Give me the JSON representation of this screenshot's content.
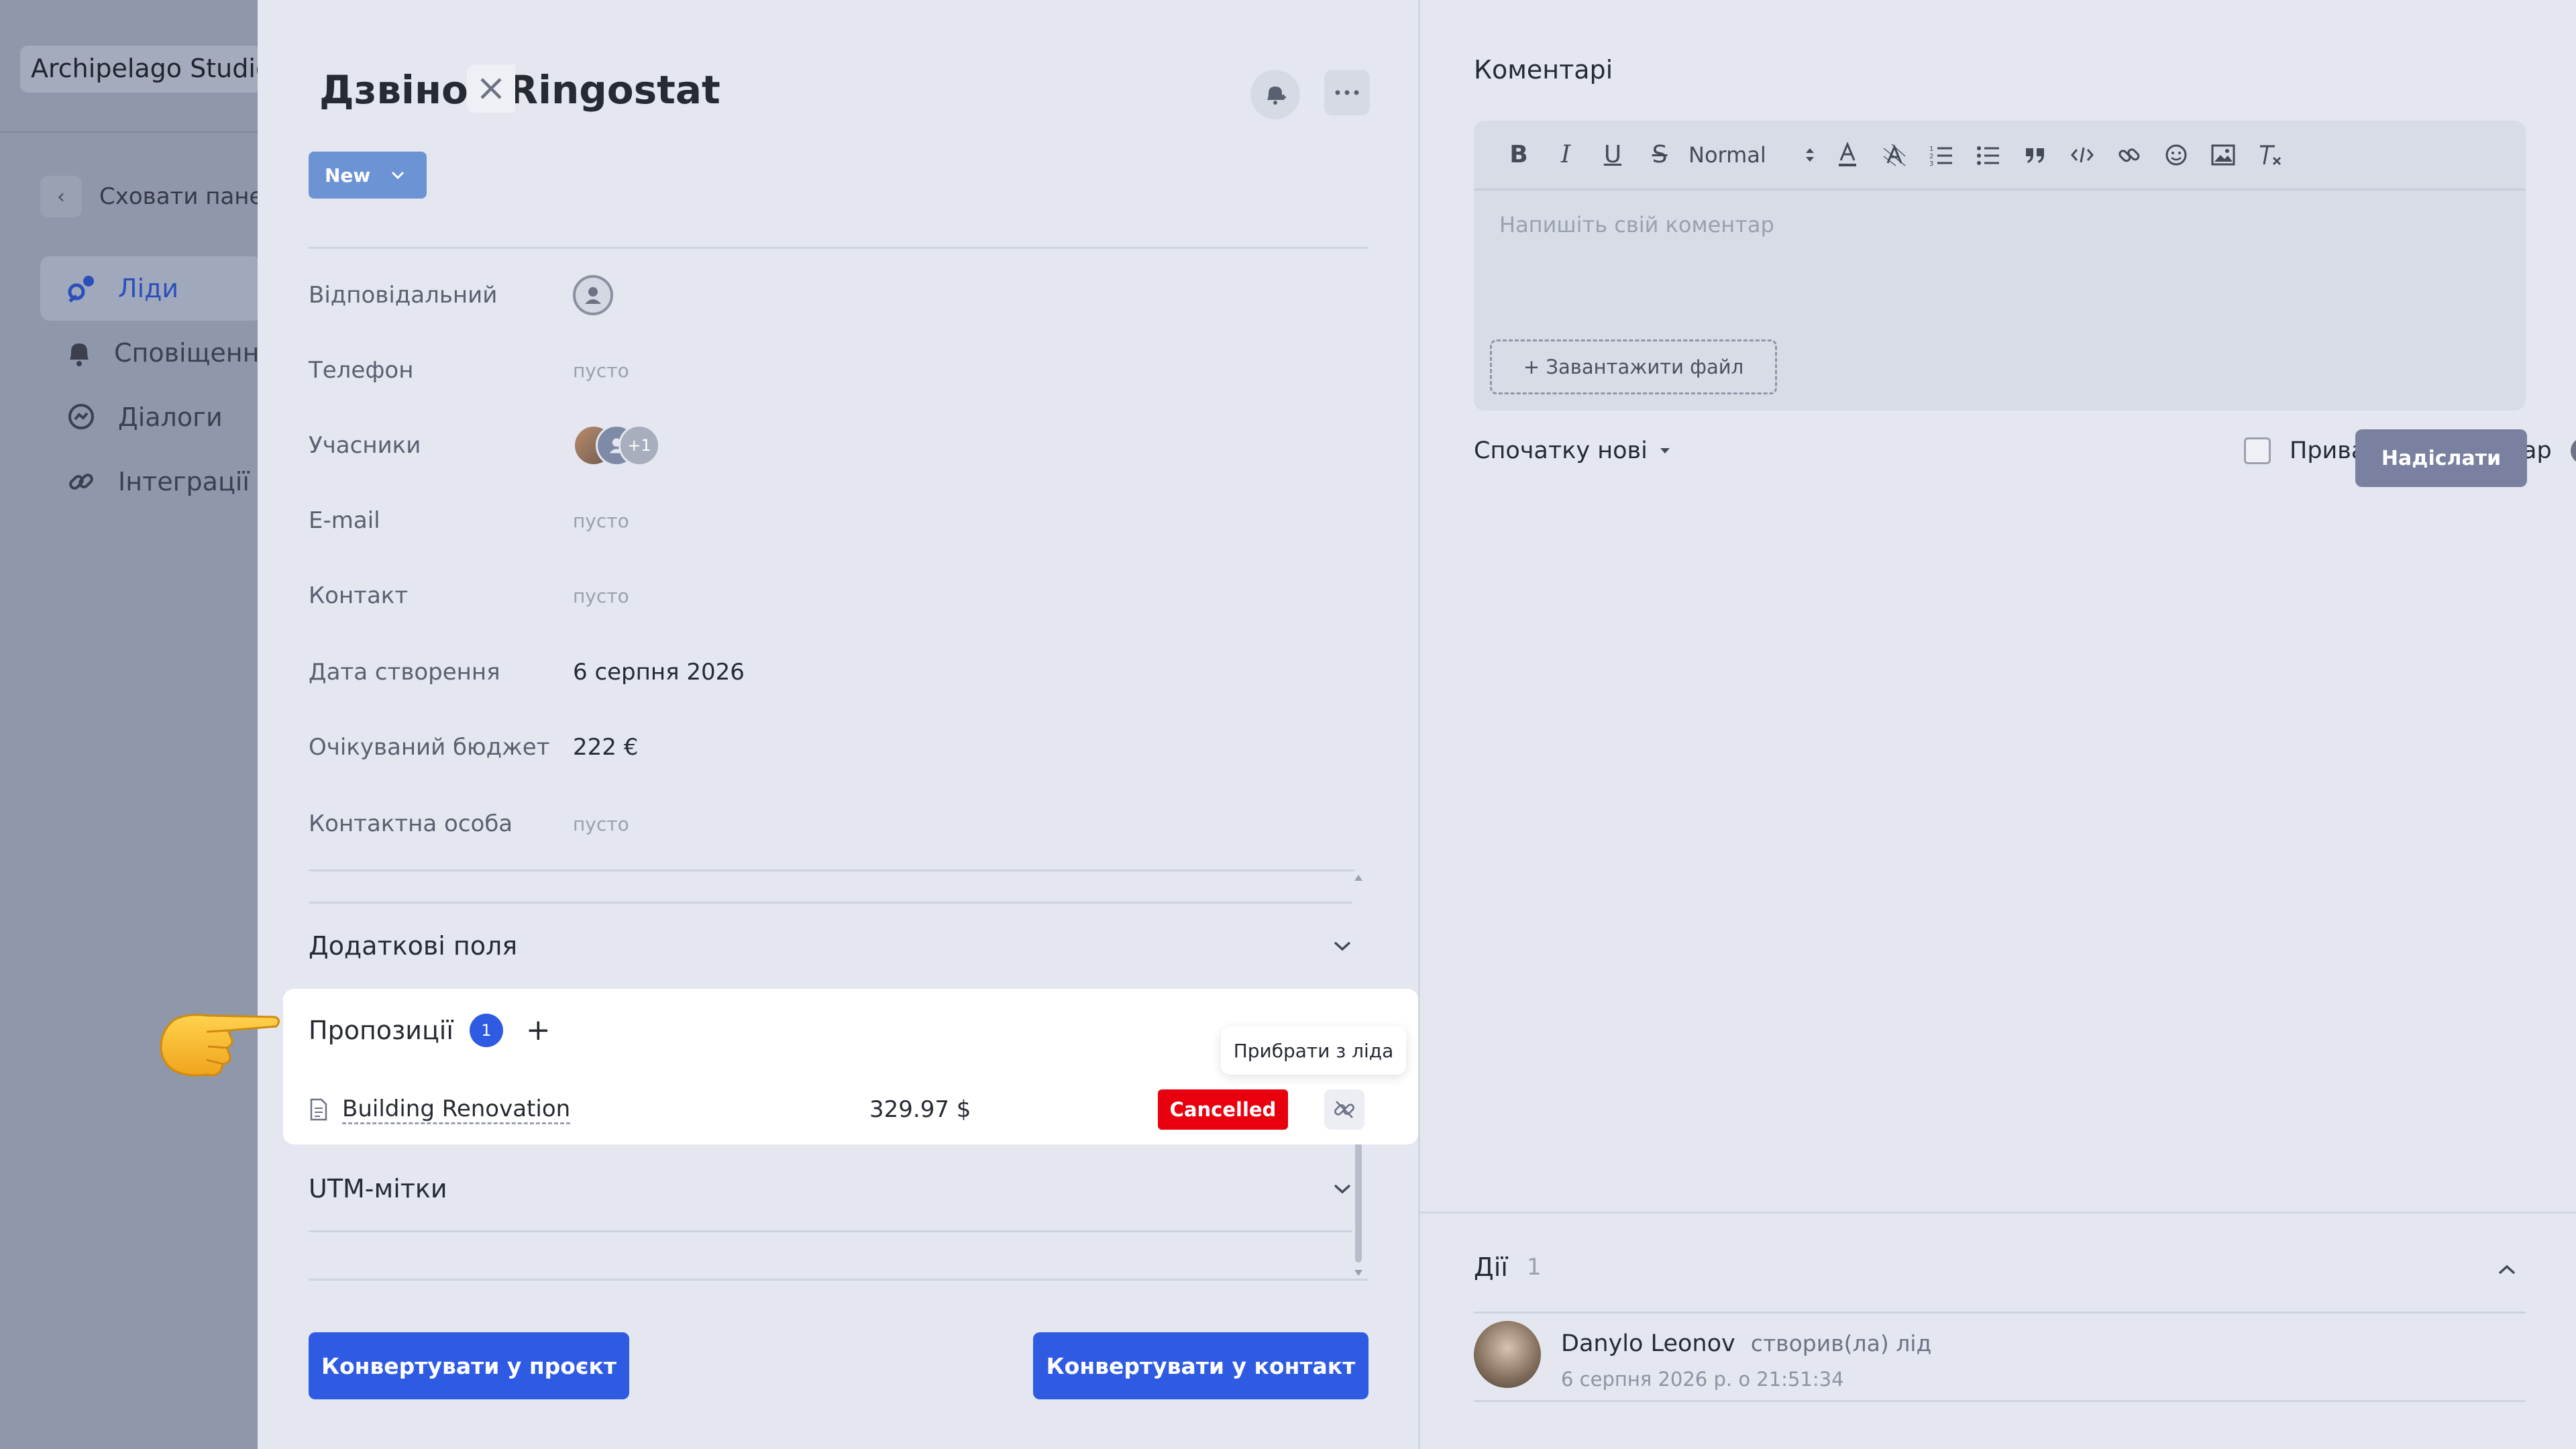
{
  "background": {
    "workspace_name": "Archipelago Studio",
    "hide_panel_label": "Сховати панель",
    "nav": [
      {
        "label": "Ліди",
        "icon": "leads-icon",
        "active": true
      },
      {
        "label": "Сповіщення",
        "icon": "bell-icon",
        "active": false
      },
      {
        "label": "Діалоги",
        "icon": "chat-icon",
        "active": false
      },
      {
        "label": "Інтеграції",
        "icon": "link-icon",
        "active": false
      }
    ]
  },
  "lead": {
    "title": "Дзвінок Ringostat",
    "status": "New",
    "fields": [
      {
        "label": "Відповідальний",
        "value": ""
      },
      {
        "label": "Телефон",
        "value": "пусто"
      },
      {
        "label": "Учасники",
        "value": "+1"
      },
      {
        "label": "E-mail",
        "value": "пусто"
      },
      {
        "label": "Контакт",
        "value": "пусто"
      },
      {
        "label": "Дата створення",
        "value": "6 серпня 2026"
      },
      {
        "label": "Очікуваний бюджет",
        "value": "222 €"
      },
      {
        "label": "Контактна особа",
        "value": "пусто"
      }
    ],
    "sections": {
      "extra_fields": "Додаткові поля",
      "proposals": "Пропозиції",
      "proposals_count": "1",
      "utm": "UTM-мітки"
    },
    "proposal": {
      "name": "Building Renovation",
      "amount": "329.97 $",
      "status": "Cancelled",
      "status_color": "#e8000e",
      "tooltip": "Прибрати з ліда"
    },
    "buttons": {
      "convert_project": "Конвертувати у проєкт",
      "convert_contact": "Конвертувати у контакт"
    }
  },
  "comments": {
    "title": "Коментарі",
    "format_select": "Normal",
    "placeholder": "Напишіть свій коментар",
    "upload": "+ Завантажити файл",
    "sort": "Спочатку нові",
    "private_label": "Приватний коментар",
    "send": "Надіслати"
  },
  "actions": {
    "title": "Дії",
    "count": "1",
    "items": [
      {
        "user": "Danylo Leonov",
        "verb": "створив(ла) лід",
        "time": "6 серпня 2026 р. о 21:51:34"
      }
    ]
  },
  "colors": {
    "accent": "#2f5be3",
    "status_new": "#6c93d3",
    "cancelled": "#e8000e"
  }
}
